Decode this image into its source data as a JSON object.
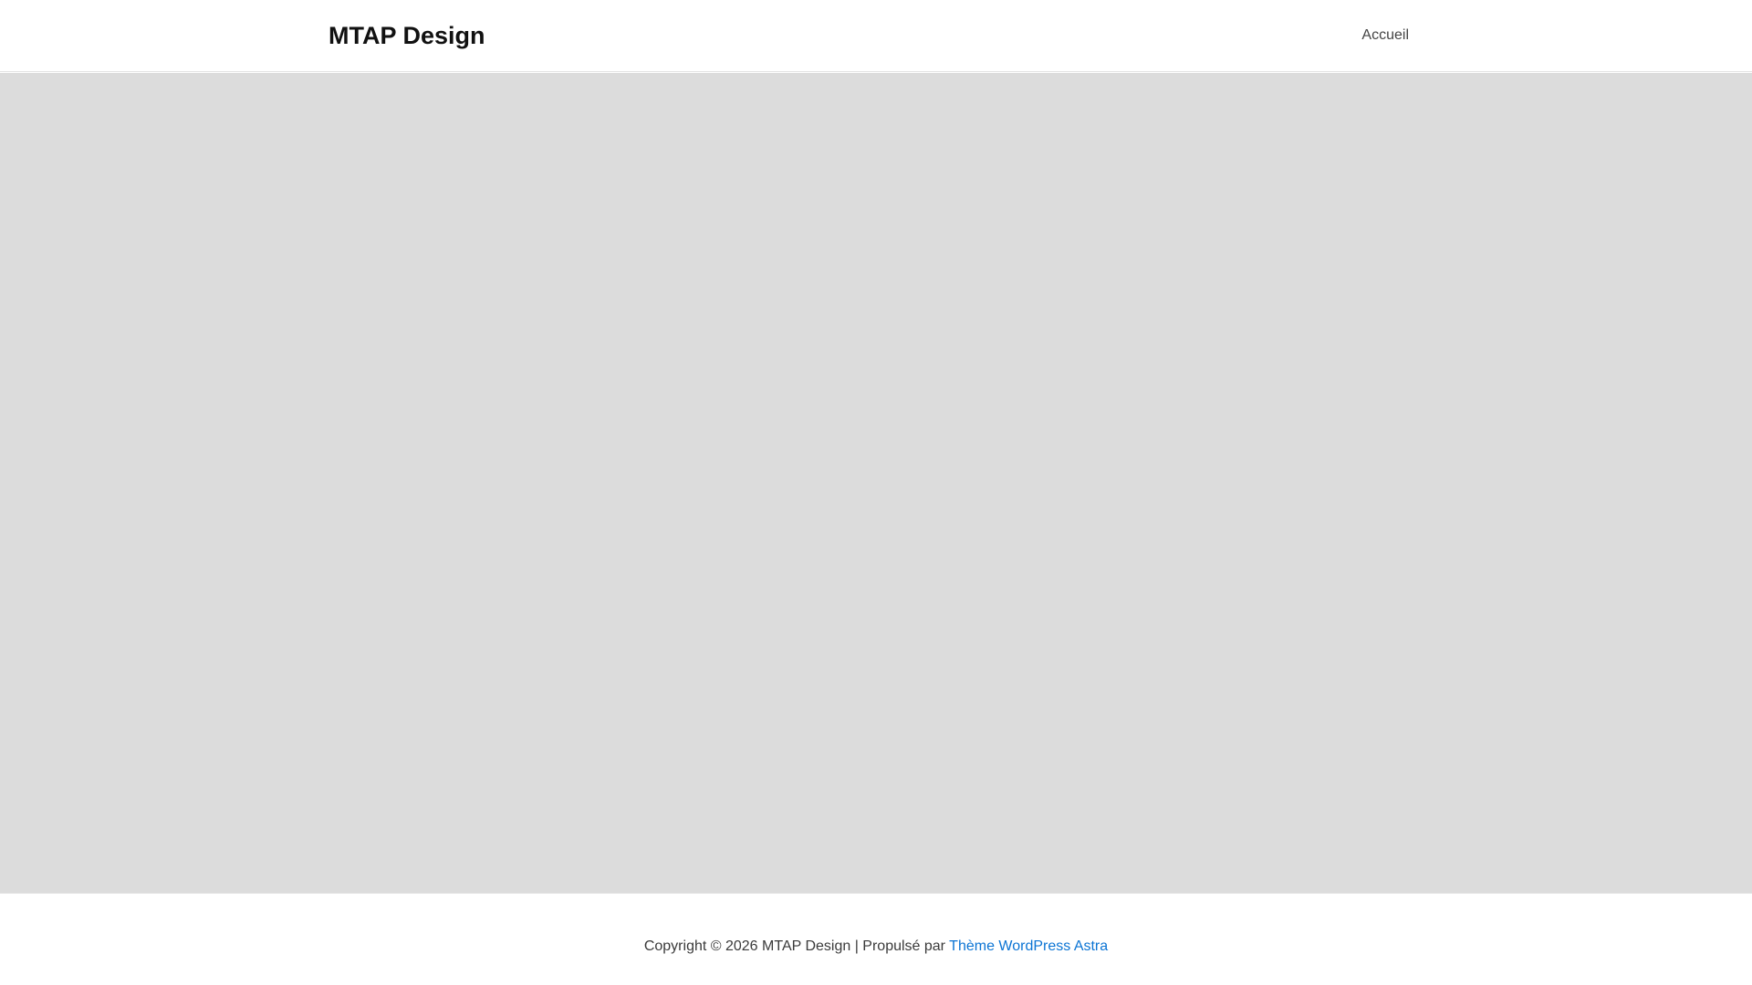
{
  "header": {
    "site_title": "MTAP Design",
    "nav": [
      {
        "label": "Accueil"
      }
    ]
  },
  "footer": {
    "copyright": "Copyright © 2026 MTAP Design | Propulsé par ",
    "theme_link": "Thème WordPress Astra"
  },
  "colors": {
    "content_background": "#dcdcdc",
    "link": "#0b74d4",
    "title": "#111111"
  }
}
